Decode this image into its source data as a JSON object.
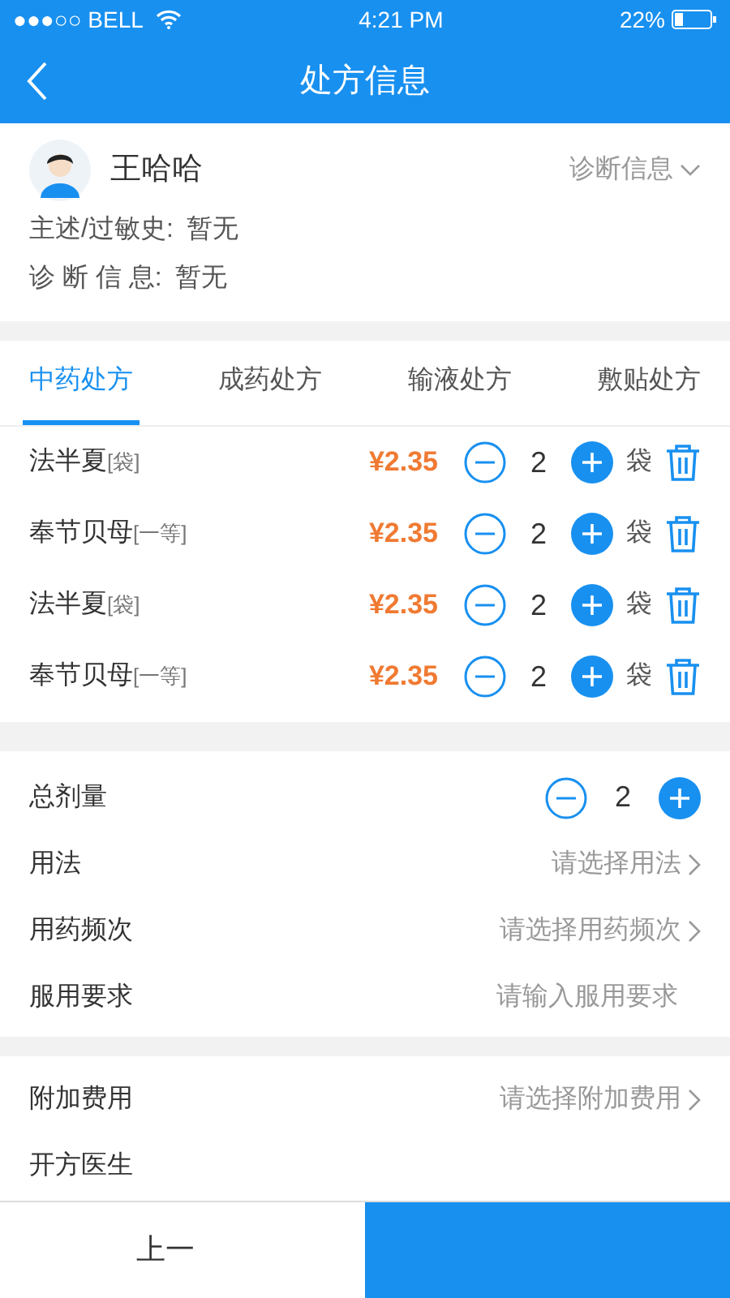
{
  "status_bar": {
    "carrier": "●●●○○ BELL",
    "time": "4:21 PM",
    "battery": "22%"
  },
  "nav": {
    "title": "处方信息"
  },
  "patient": {
    "name": "王哈哈",
    "toggle": "诊断信息",
    "complaint_label": "主述/过敏史:",
    "complaint": "暂无",
    "diagnosis_label": "诊 断 信 息:",
    "diagnosis": "暂无"
  },
  "tabs": [
    {
      "label": "中药处方",
      "selected": true
    },
    {
      "label": "成药处方",
      "selected": false
    },
    {
      "label": "输液处方",
      "selected": false
    },
    {
      "label": "敷贴处方",
      "selected": false
    }
  ],
  "items": [
    {
      "name": "法半夏",
      "spec": "[袋]",
      "price": "¥2.35",
      "qty": "2",
      "unit": "袋"
    },
    {
      "name": "奉节贝母",
      "spec": "[一等]",
      "price": "¥2.35",
      "qty": "2",
      "unit": "袋"
    },
    {
      "name": "法半夏",
      "spec": "[袋]",
      "price": "¥2.35",
      "qty": "2",
      "unit": "袋"
    },
    {
      "name": "奉节贝母",
      "spec": "[一等]",
      "price": "¥2.35",
      "qty": "2",
      "unit": "袋"
    }
  ],
  "form": [
    {
      "kind": "stepper",
      "label": "总剂量",
      "value": "2"
    },
    {
      "kind": "select",
      "label": "用法",
      "placeholder": "请选择用法"
    },
    {
      "kind": "select",
      "label": "用药频次",
      "placeholder": "请选择用药频次"
    },
    {
      "kind": "input",
      "label": "服用要求",
      "placeholder": "请输入服用要求"
    }
  ],
  "extra": [
    {
      "kind": "select",
      "label": "附加费用",
      "placeholder": "请选择附加费用"
    },
    {
      "kind": "plain",
      "label": "开方医生"
    }
  ],
  "bottom_bar": {
    "back": "上一"
  }
}
